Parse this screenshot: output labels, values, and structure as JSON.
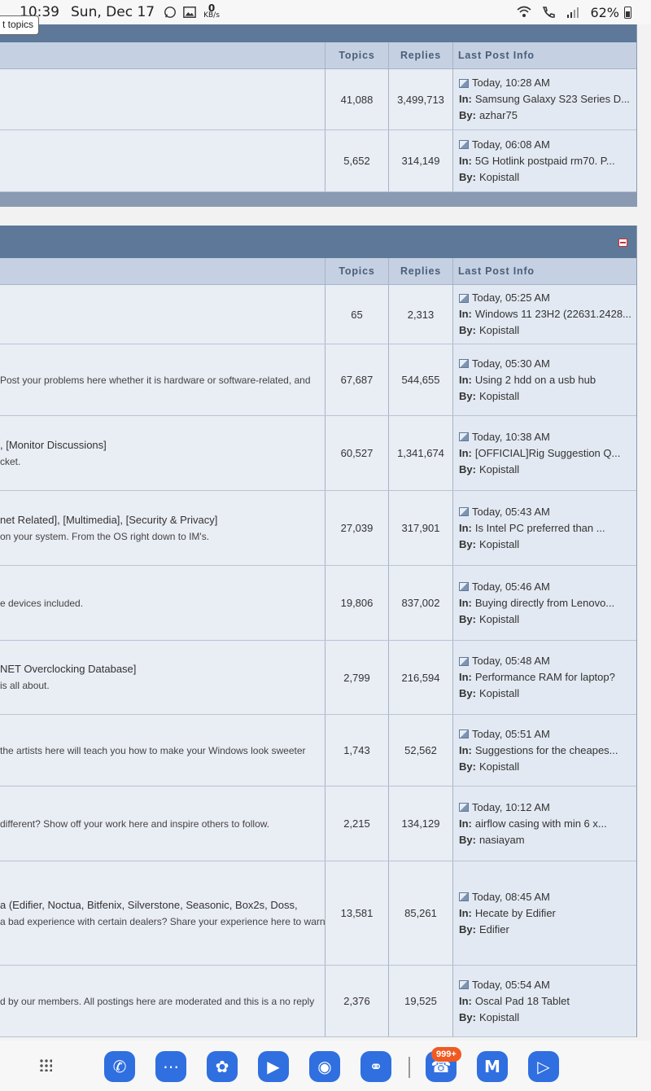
{
  "status_bar": {
    "time": "10:39",
    "date": "Sun, Dec 17",
    "speed_value": "0",
    "speed_unit": "KB/s",
    "battery": "62%"
  },
  "tooltip": "t topics",
  "section1": {
    "headers": {
      "topics": "Topics",
      "replies": "Replies",
      "last_post": "Last Post Info"
    },
    "rows": [
      {
        "topics": "41,088",
        "replies": "3,499,713",
        "time": "Today, 10:28 AM",
        "in_label": "In:",
        "in": "Samsung Galaxy S23 Series D...",
        "by_label": "By:",
        "by": "azhar75"
      },
      {
        "topics": "5,652",
        "replies": "314,149",
        "time": "Today, 06:08 AM",
        "in_label": "In:",
        "in": "5G Hotlink postpaid rm70. P...",
        "by_label": "By:",
        "by": "Kopistall"
      }
    ]
  },
  "section2": {
    "headers": {
      "topics": "Topics",
      "replies": "Replies",
      "last_post": "Last Post Info"
    },
    "rows": [
      {
        "name": "",
        "desc": "",
        "topics": "65",
        "replies": "2,313",
        "time": "Today, 05:25 AM",
        "in": "Windows 11 23H2 (22631.2428...",
        "by": "Kopistall"
      },
      {
        "name": "",
        "desc": "Post your problems here whether it is hardware or software-related, and",
        "topics": "67,687",
        "replies": "544,655",
        "time": "Today, 05:30 AM",
        "in": "Using 2 hdd on a usb hub",
        "by": "Kopistall"
      },
      {
        "name": ", [Monitor Discussions]",
        "desc": "cket.",
        "topics": "60,527",
        "replies": "1,341,674",
        "time": "Today, 10:38 AM",
        "in": "[OFFICIAL]Rig Suggestion Q...",
        "by": "Kopistall"
      },
      {
        "name": "net Related], [Multimedia], [Security & Privacy]",
        "desc": "on your system. From the OS right down to IM's.",
        "topics": "27,039",
        "replies": "317,901",
        "time": "Today, 05:43 AM",
        "in": "Is Intel PC preferred than ...",
        "by": "Kopistall"
      },
      {
        "name": "",
        "desc": "e devices included.",
        "topics": "19,806",
        "replies": "837,002",
        "time": "Today, 05:46 AM",
        "in": "Buying directly from Lenovo...",
        "by": "Kopistall"
      },
      {
        "name": "NET Overclocking Database]",
        "desc": "is all about.",
        "topics": "2,799",
        "replies": "216,594",
        "time": "Today, 05:48 AM",
        "in": "Performance RAM for laptop?",
        "by": "Kopistall"
      },
      {
        "name": "",
        "desc": "the artists here will teach you how to make your Windows look sweeter",
        "topics": "1,743",
        "replies": "52,562",
        "time": "Today, 05:51 AM",
        "in": "Suggestions for the cheapes...",
        "by": "Kopistall"
      },
      {
        "name": "",
        "desc": "different? Show off your work here and inspire others to follow.",
        "topics": "2,215",
        "replies": "134,129",
        "time": "Today, 10:12 AM",
        "in": "airflow casing with min 6 x...",
        "by": "nasiayam"
      },
      {
        "name": "a (Edifier, Noctua, Bitfenix, Silverstone, Seasonic, Box2s, Doss,",
        "desc": "a bad experience with certain dealers? Share your experience here to warn",
        "topics": "13,581",
        "replies": "85,261",
        "time": "Today, 08:45 AM",
        "in": "Hecate by Edifier",
        "by": "Edifier"
      },
      {
        "name": "",
        "desc": "d by our members. All postings here are moderated and this is a no reply",
        "topics": "2,376",
        "replies": "19,525",
        "time": "Today, 05:54 AM",
        "in": "Oscal Pad 18 Tablet",
        "by": "Kopistall"
      }
    ]
  },
  "labels": {
    "in": "In:",
    "by": "By:"
  },
  "dock": {
    "badge": "999+",
    "apps": [
      "phone-icon",
      "messages-icon",
      "flower-icon",
      "play-store-icon",
      "camera-icon",
      "internet-icon",
      "whatsapp-icon",
      "m-app-icon",
      "youtube-icon"
    ]
  },
  "colors": {
    "header": "#5d7899",
    "thead": "#c5d1e2",
    "row": "#e6ebf3",
    "dock_app": "#2f6fe0",
    "badge": "#f05a22"
  }
}
